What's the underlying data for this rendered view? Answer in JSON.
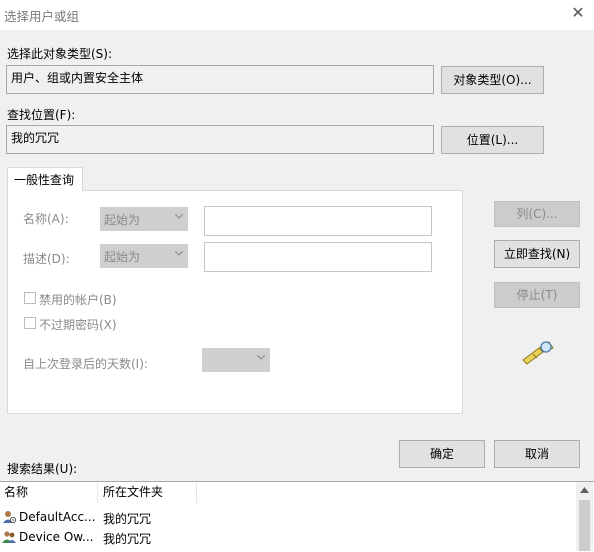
{
  "window": {
    "title": "选择用户或组",
    "close_glyph": "✕"
  },
  "object_types": {
    "label": "选择此对象类型(S):",
    "value": "用户、组或内置安全主体",
    "button": "对象类型(O)..."
  },
  "location": {
    "label": "查找位置(F):",
    "value": "我的冗冗",
    "button": "位置(L)..."
  },
  "tab": {
    "label": "一般性查询"
  },
  "query": {
    "name_label": "名称(A):",
    "name_mode": "起始为",
    "desc_label": "描述(D):",
    "desc_mode": "起始为",
    "disabled_accounts": "禁用的帐户(B)",
    "non_expiring_pw": "不过期密码(X)",
    "days_since_logon": "自上次登录后的天数(I):"
  },
  "side_buttons": {
    "columns": "列(C)...",
    "find_now": "立即查找(N)",
    "stop": "停止(T)"
  },
  "dialog_buttons": {
    "ok": "确定",
    "cancel": "取消"
  },
  "results": {
    "label": "搜索结果(U):",
    "columns": [
      "名称",
      "所在文件夹"
    ],
    "rows": [
      {
        "name": "DefaultAcc...",
        "folder": "我的冗冗",
        "icon": "user-icon"
      },
      {
        "name": "Device Ow...",
        "folder": "我的冗冗",
        "icon": "user-group-icon"
      }
    ]
  },
  "colors": {
    "accent": "#0078d7",
    "disabled_text": "#8a8a8a"
  }
}
